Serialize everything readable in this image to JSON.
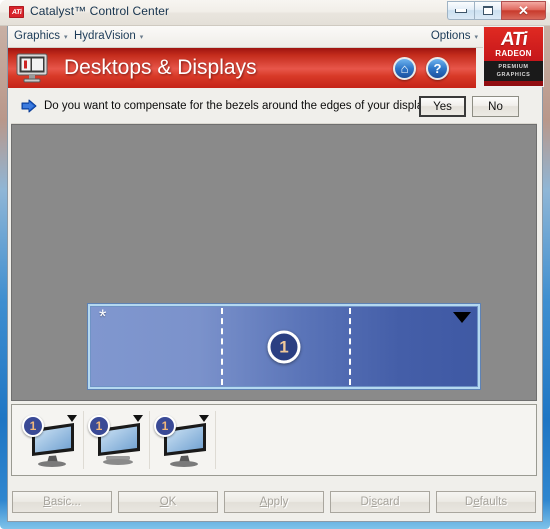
{
  "window": {
    "title": "Catalyst™ Control Center",
    "app_icon": "ati-logo-icon",
    "controls": {
      "minimize": "minimize-button",
      "maximize": "maximize-button",
      "close": "✕"
    }
  },
  "menubar": {
    "items": [
      {
        "label": "Graphics",
        "caret": "▾"
      },
      {
        "label": "HydraVision",
        "caret": "▾"
      }
    ],
    "options": {
      "label": "Options",
      "caret": "▾"
    }
  },
  "brand": {
    "ati": "ATi",
    "radeon": "RADEON",
    "premium_line1": "PREMIUM",
    "premium_line2": "GRAPHICS",
    "accent_red": "#c4151a"
  },
  "banner": {
    "title": "Desktops & Displays",
    "icon": "monitor-icon",
    "home_glyph": "⌂",
    "help_glyph": "?",
    "accent": "#d83a28"
  },
  "prompt": {
    "icon": "blue-arrow-icon",
    "text": "Do you want to compensate for the bezels around the edges of  your displays?",
    "yes_label": "Yes",
    "no_label": "No"
  },
  "workspace": {
    "background": "#8a8a8a",
    "display": {
      "marker": "*",
      "badge_number": "1",
      "caret": "▼",
      "segments": 3,
      "border_color": "#b4d8f0"
    }
  },
  "thumbnails": [
    {
      "badge": "1",
      "caret": "▼",
      "icon": "monitor-thumbnail-icon"
    },
    {
      "badge": "1",
      "caret": "▼",
      "icon": "monitor-thumbnail-icon"
    },
    {
      "badge": "1",
      "caret": "▼",
      "icon": "monitor-thumbnail-icon"
    }
  ],
  "footer": {
    "buttons": [
      {
        "pre": "",
        "key": "B",
        "post": "asic...",
        "enabled": false
      },
      {
        "pre": "",
        "key": "O",
        "post": "K",
        "enabled": false
      },
      {
        "pre": "",
        "key": "A",
        "post": "pply",
        "enabled": false
      },
      {
        "pre": "Di",
        "key": "s",
        "post": "card",
        "enabled": false
      },
      {
        "pre": "D",
        "key": "e",
        "post": "faults",
        "enabled": false
      }
    ]
  }
}
